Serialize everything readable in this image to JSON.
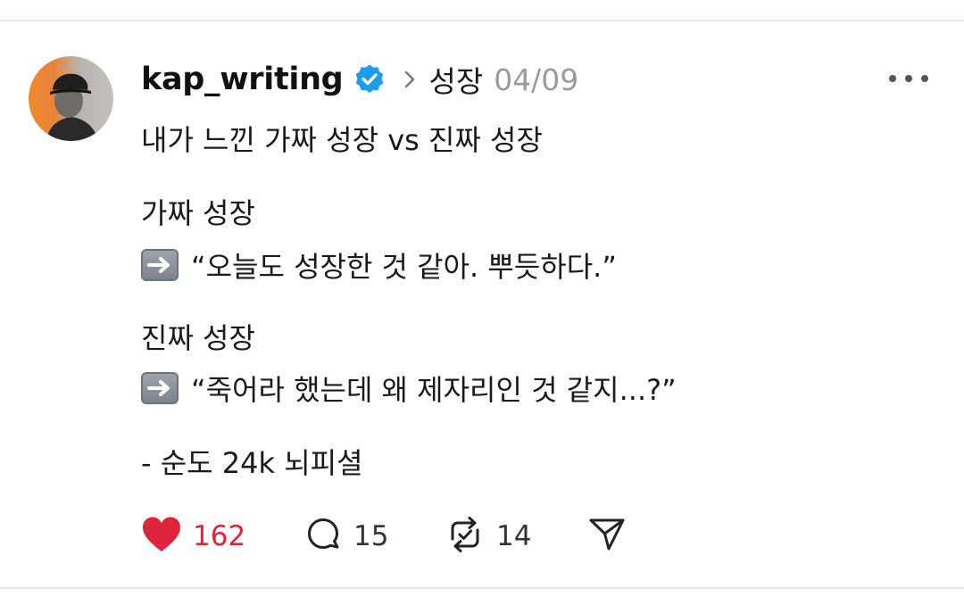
{
  "post": {
    "username": "kap_writing",
    "topic": "성장",
    "timestamp": "04/09",
    "lines": [
      "내가 느낀 가짜 성장 vs 진짜 성장",
      "가짜 성장",
      "“오늘도 성장한 것 같아. 뿌듯하다.”",
      "진짜 성장",
      "“죽어라 했는데 왜 제자리인 것 같지...?”",
      "- 순도 24k 뇌피셜"
    ]
  },
  "actions": {
    "likes": "162",
    "replies": "15",
    "reposts": "14"
  },
  "icons": {
    "verified": "verified-badge-icon",
    "chevron": "chevron-right-icon",
    "more": "more-horizontal-icon",
    "arrow": "right-arrow-emoji-icon",
    "like": "heart-icon",
    "reply": "comment-icon",
    "repost": "repost-icon",
    "share": "send-icon"
  },
  "colors": {
    "verified": "#1d9bf0",
    "like": "#e0243c",
    "timestamp": "#9a9a9a"
  }
}
